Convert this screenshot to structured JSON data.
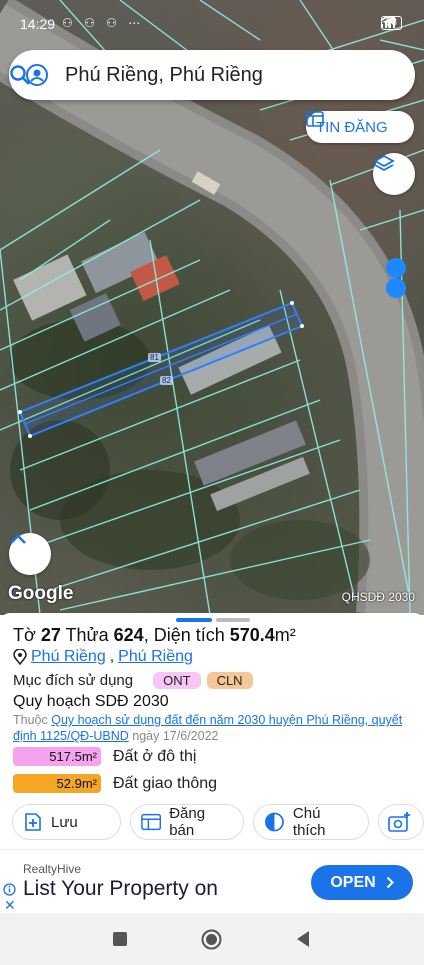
{
  "status_bar": {
    "time": "14:29",
    "notif_icons": "⚇ ⚇ ⚇ ⋯",
    "battery": "88"
  },
  "search": {
    "query": "Phú Riềng, Phú Riềng"
  },
  "map": {
    "tin_dang_label": "TIN ĐĂNG",
    "google_label": "Google",
    "layer_label": "QHSDĐ 2030",
    "parcel_labels": [
      "81",
      "82"
    ]
  },
  "panel": {
    "sheet_label": "Tờ",
    "sheet_no": "27",
    "lot_label": "Thửa",
    "lot_no": "624",
    "area_label": ", Diện tích",
    "area_value": "570.4",
    "area_unit": "m²",
    "location_1": "Phú Riềng",
    "location_sep": ",",
    "location_2": "Phú Riềng",
    "purpose_label": "Mục đích sử dụng",
    "purpose_tags": [
      "ONT",
      "CLN"
    ],
    "plan_title": "Quy hoạch SDĐ 2030",
    "note_prefix": "Thuộc",
    "note_link": "Quy hoạch sử dụng đất đến năm 2030 huyện Phú Riềng, quyết định 1125/QĐ-UBND",
    "note_suffix": "ngày 17/6/2022",
    "areas": [
      {
        "value": "517.5m²",
        "label": "Đất ở đô thị",
        "color": "#f5a3f0"
      },
      {
        "value": "52.9m²",
        "label": "Đất giao thông",
        "color": "#f5a623"
      }
    ],
    "actions": {
      "save": "Lưu",
      "sell": "Đăng bán",
      "legend": "Chú thích"
    }
  },
  "ad": {
    "brand": "RealtyHive",
    "headline": "List Your Property on",
    "cta": "OPEN"
  },
  "colors": {
    "accent": "#1a73e8",
    "parcel_outline": "#8ff0e0",
    "selected_parcel": "#2f7fff"
  }
}
